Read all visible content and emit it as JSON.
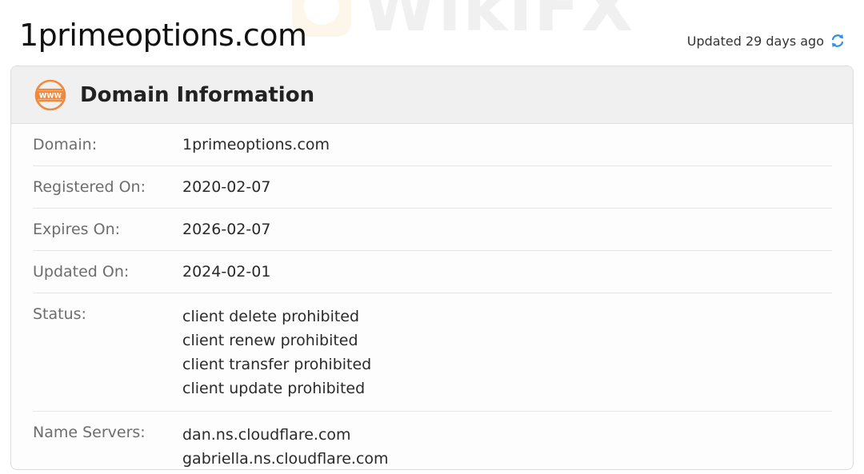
{
  "header": {
    "site_title": "1primeoptions.com",
    "updated_text": "Updated 29 days ago",
    "refresh_icon": "refresh-icon"
  },
  "watermark": {
    "text": "WikiFX"
  },
  "card": {
    "title": "Domain Information",
    "icon": "www-icon",
    "rows": [
      {
        "label": "Domain:",
        "values": [
          "1primeoptions.com"
        ]
      },
      {
        "label": "Registered On:",
        "values": [
          "2020-02-07"
        ]
      },
      {
        "label": "Expires On:",
        "values": [
          "2026-02-07"
        ]
      },
      {
        "label": "Updated On:",
        "values": [
          "2024-02-01"
        ]
      },
      {
        "label": "Status:",
        "values": [
          "client delete prohibited",
          "client renew prohibited",
          "client transfer prohibited",
          "client update prohibited"
        ]
      },
      {
        "label": "Name Servers:",
        "values": [
          "dan.ns.cloudflare.com",
          "gabriella.ns.cloudflare.com"
        ]
      }
    ]
  },
  "colors": {
    "accent_orange": "#f0893c",
    "refresh_blue": "#2f8fe0"
  }
}
